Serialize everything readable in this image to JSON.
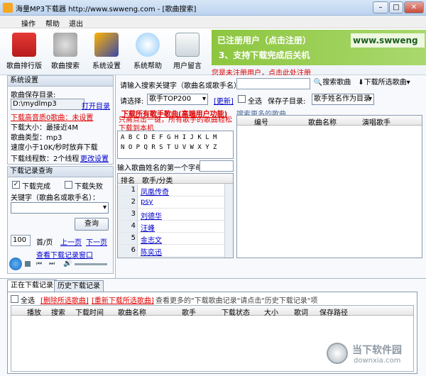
{
  "window": {
    "title": "海量MP3下载器  http://www.swweng.com - [歌曲搜索]",
    "min": "–",
    "max": "□",
    "close": "✕"
  },
  "menu": [
    "操作",
    "帮助",
    "退出"
  ],
  "toolbar": [
    {
      "label": "歌曲排行版",
      "icon": "chart-icon"
    },
    {
      "label": "歌曲搜索",
      "icon": "music-icon"
    },
    {
      "label": "系统设置",
      "icon": "tools-icon"
    },
    {
      "label": "系统帮助",
      "icon": "help-icon"
    },
    {
      "label": "用户留言",
      "icon": "note-icon"
    }
  ],
  "banner": {
    "line1": "已注册用户（点击注册）",
    "line2": "3、支持下载完成后关机",
    "url": "www.swweng"
  },
  "register_link": "您是未注册用户，点击此处注册",
  "system": {
    "title": "系统设置",
    "save_dir_label": "歌曲保存目录:",
    "save_dir_value": "D:\\mydlmp3",
    "open_dir": "打开目录",
    "hq_info": "下载高音质0歌曲：未设置",
    "max_size": "下载大小：最接近4M",
    "type": "歌曲类型：mp3",
    "speed": "速度小于10K/秒时放弃下载",
    "threads": "下载线程数：2个线程",
    "change": "更改设置"
  },
  "query": {
    "title": "下载记录查询",
    "done": "下载完成",
    "fail": "下载失败",
    "keyword_label": "关键字（歌曲名或歌手名）：",
    "query_btn": "查询",
    "page_size": "100",
    "first": "首/页",
    "prev": "上一页",
    "next": "下一页",
    "more": "查看下载记录窗口"
  },
  "search": {
    "prompt": "请输入搜索关键字（歌曲名或歌手名）：",
    "search_btn": "搜索歌曲",
    "download_btn": "下载所选歌曲",
    "choose_label": "请选择:",
    "choose_value": "歌手TOP200",
    "refresh": "[更新]",
    "select_all": "全选",
    "subdir_label": "保存子目录:",
    "subdir_value": "歌手姓名作为目录",
    "all_singer_link": "下载所有歌手歌曲(高端用户功能)",
    "all_singer_desc": "只需点击一键，所有歌手的歌曲轻松下载到本机",
    "more_search": "搜索更多的歌曲...",
    "letters_row1": "A B C D E F G H I J K L M",
    "letters_row2": "N O P Q R S T U V W X Y Z",
    "first_char_label": "输入歌曲姓名的第一个字母："
  },
  "singer_table": {
    "headers": [
      "排名",
      "歌手/分类"
    ],
    "rows": [
      {
        "rank": "1",
        "name": "凤凰传奇"
      },
      {
        "rank": "2",
        "name": "psy"
      },
      {
        "rank": "3",
        "name": "刘德华"
      },
      {
        "rank": "4",
        "name": "汪峰"
      },
      {
        "rank": "5",
        "name": "金志文"
      },
      {
        "rank": "6",
        "name": "陈奕迅"
      }
    ]
  },
  "song_table": {
    "headers": [
      "编号",
      "歌曲名称",
      "演唱歌手"
    ]
  },
  "bottom": {
    "tab_downloading": "正在下载记录",
    "tab_history": "历史下载记录",
    "select_all": "全选",
    "delete_link": "[删除所选歌曲]",
    "redownload_link": "[重新下载所选歌曲]",
    "hint": "查看更多的\"下载歌曲记录\"请点击\"历史下载记录\"项",
    "headers": [
      "播放",
      "搜索",
      "下载时间",
      "歌曲名称",
      "歌手",
      "下载状态",
      "大小",
      "歌词",
      "保存路径"
    ]
  },
  "watermark": {
    "text": "当下软件园",
    "sub": "downxia.com"
  }
}
